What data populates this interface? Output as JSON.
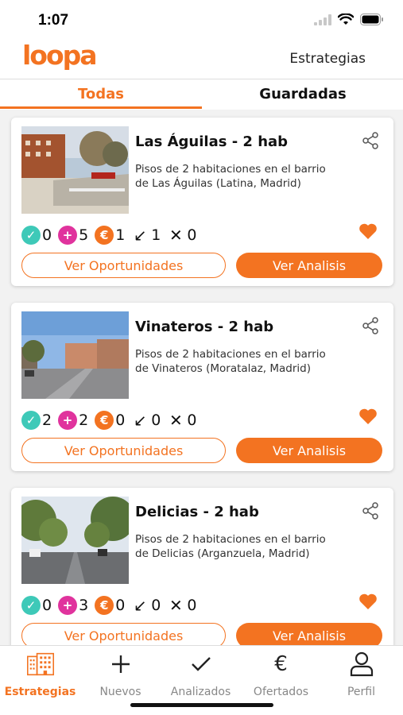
{
  "status_bar": {
    "time": "1:07"
  },
  "header": {
    "logo": "loopa",
    "link": "Estrategias"
  },
  "tabs": [
    {
      "label": "Todas",
      "active": true
    },
    {
      "label": "Guardadas",
      "active": false
    }
  ],
  "cards": [
    {
      "title": "Las Águilas - 2 hab",
      "description": "Pisos de 2 habitaciones en el barrio de Las Águilas (Latina, Madrid)",
      "stats": {
        "checked": "0",
        "new": "5",
        "offered": "1",
        "down": "1",
        "discarded": "0"
      },
      "favorite": true,
      "buttons": {
        "opportunities": "Ver Oportunidades",
        "analysis": "Ver Analisis"
      }
    },
    {
      "title": "Vinateros - 2 hab",
      "description": "Pisos de 2 habitaciones en el barrio de Vinateros (Moratalaz, Madrid)",
      "stats": {
        "checked": "2",
        "new": "2",
        "offered": "0",
        "down": "0",
        "discarded": "0"
      },
      "favorite": true,
      "buttons": {
        "opportunities": "Ver Oportunidades",
        "analysis": "Ver Analisis"
      }
    },
    {
      "title": "Delicias - 2 hab",
      "description": "Pisos de 2 habitaciones en el barrio de Delicias (Arganzuela, Madrid)",
      "stats": {
        "checked": "0",
        "new": "3",
        "offered": "0",
        "down": "0",
        "discarded": "0"
      },
      "favorite": true,
      "buttons": {
        "opportunities": "Ver Oportunidades",
        "analysis": "Ver Analisis"
      }
    }
  ],
  "nav": [
    {
      "label": "Estrategias",
      "icon": "buildings-icon",
      "active": true
    },
    {
      "label": "Nuevos",
      "icon": "plus-icon",
      "active": false
    },
    {
      "label": "Analizados",
      "icon": "check-icon",
      "active": false
    },
    {
      "label": "Ofertados",
      "icon": "euro-icon",
      "active": false
    },
    {
      "label": "Perfil",
      "icon": "user-icon",
      "active": false
    }
  ],
  "colors": {
    "accent": "#f37321",
    "check_badge": "#3ec9b8",
    "new_badge": "#e0339d",
    "offer_badge": "#f37321"
  }
}
